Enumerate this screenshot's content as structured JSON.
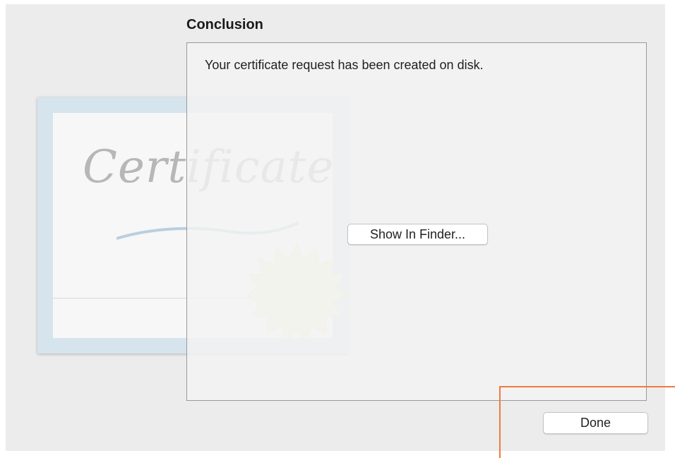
{
  "dialog": {
    "heading": "Conclusion",
    "message": "Your certificate request has been created on disk.",
    "show_in_finder_label": "Show In Finder...",
    "done_label": "Done"
  },
  "illustration": {
    "certificate_text": "Certificate"
  },
  "colors": {
    "window_bg": "#ececec",
    "annotation": "#f07b3f"
  }
}
